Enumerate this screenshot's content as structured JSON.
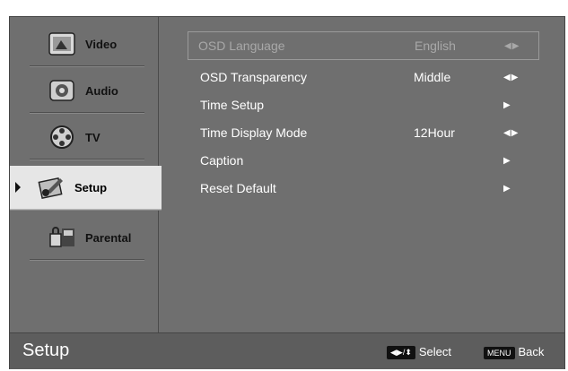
{
  "sidebar": {
    "items": [
      {
        "label": "Video",
        "icon": "video-icon"
      },
      {
        "label": "Audio",
        "icon": "audio-icon"
      },
      {
        "label": "TV",
        "icon": "tv-reel-icon"
      },
      {
        "label": "Setup",
        "icon": "setup-icon",
        "active": true
      },
      {
        "label": "Parental",
        "icon": "parental-icon"
      }
    ]
  },
  "menu": {
    "rows": [
      {
        "label": "OSD Language",
        "value": "English",
        "control": "◀▶",
        "disabled": true
      },
      {
        "label": "OSD Transparency",
        "value": "Middle",
        "control": "◀▶"
      },
      {
        "label": "Time Setup",
        "value": "",
        "control": "▶"
      },
      {
        "label": "Time Display Mode",
        "value": "12Hour",
        "control": "◀▶"
      },
      {
        "label": "Caption",
        "value": "",
        "control": "▶"
      },
      {
        "label": "Reset Default",
        "value": "",
        "control": "▶"
      }
    ]
  },
  "footer": {
    "title": "Setup",
    "select_keys": "◀▶/⬍",
    "select_label": "Select",
    "back_key": "MENU",
    "back_label": "Back"
  }
}
